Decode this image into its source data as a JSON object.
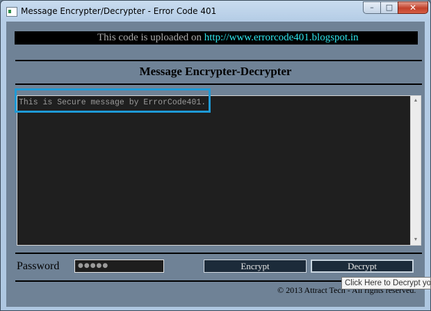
{
  "window": {
    "title": "Message Encrypter/Decrypter - Error Code 401",
    "icon": "app-window-icon",
    "controls": {
      "minimize": "–",
      "maximize": "□",
      "close": "✕"
    }
  },
  "banner": {
    "text": "This code is uploaded on ",
    "link": "http://www.errorcode401.blogspot.in",
    "text_color": "#a9a9a9",
    "link_color": "#2fe3ea"
  },
  "heading": "Message Encrypter-Decrypter",
  "message": {
    "value": "This is Secure message by ErrorCode401.",
    "highlight_color": "#1e9ad6"
  },
  "scrollbar": {
    "up_icon": "▲",
    "down_icon": "▼"
  },
  "password": {
    "label": "Password",
    "masked_value": "●●●●●"
  },
  "buttons": {
    "encrypt": "Encrypt",
    "decrypt": "Decrypt"
  },
  "footer": "© 2013 Attract Tech - All rights reserved.",
  "tooltip": "Click Here to Decrypt your"
}
